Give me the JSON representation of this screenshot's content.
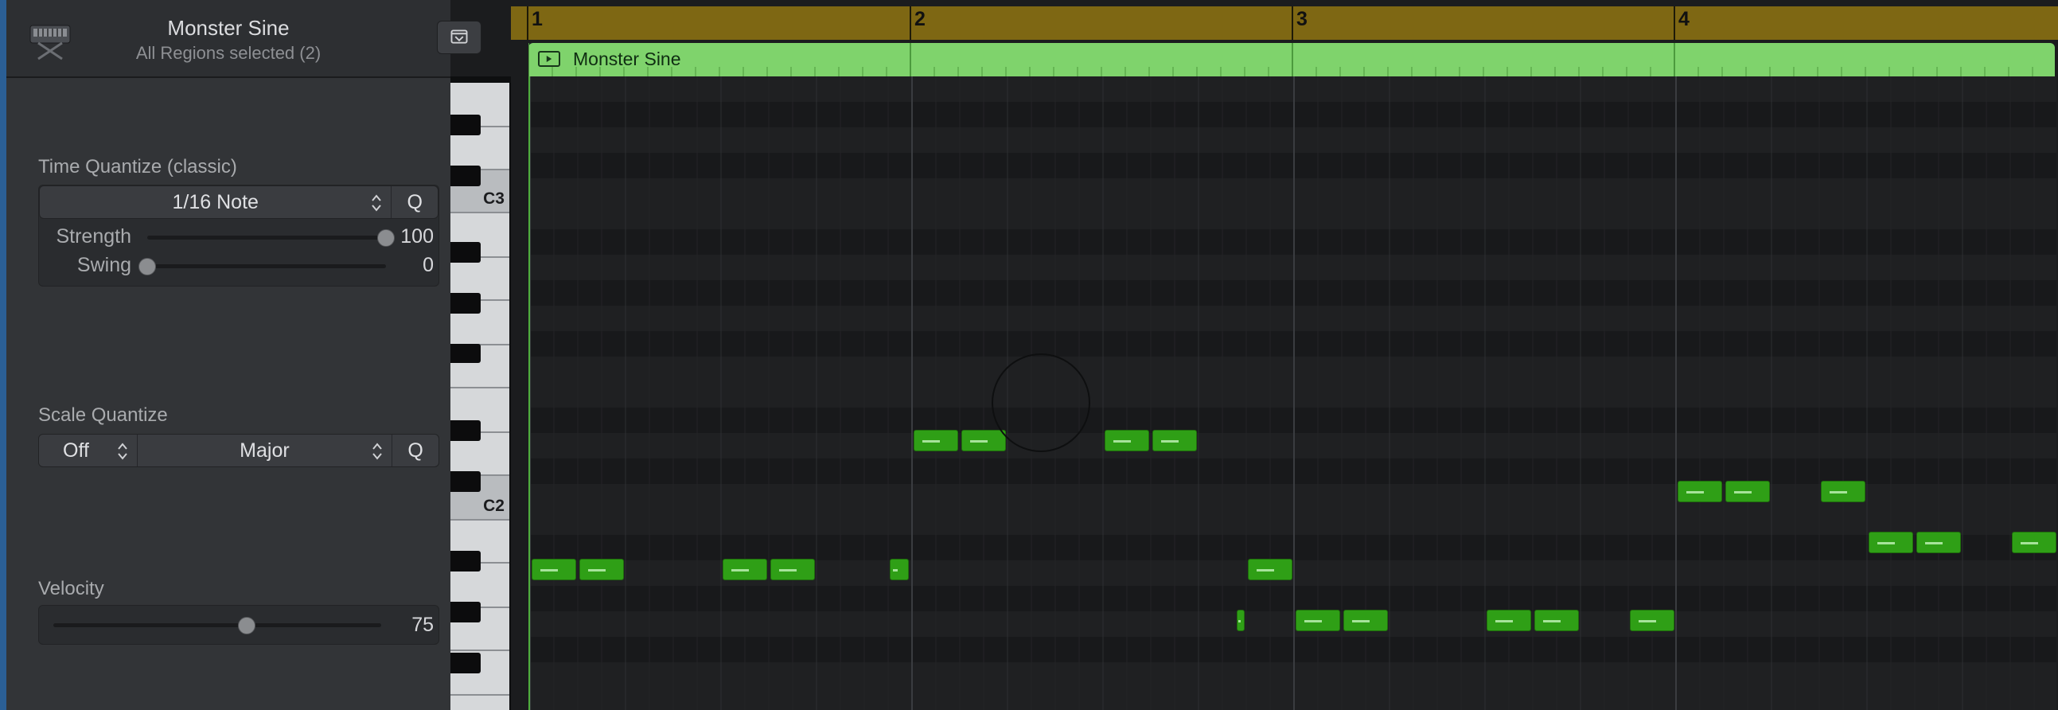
{
  "header": {
    "region_name": "Monster Sine",
    "region_sub": "All Regions selected (2)"
  },
  "time_quantize": {
    "title": "Time Quantize (classic)",
    "value": "1/16 Note",
    "q_label": "Q",
    "strength_label": "Strength",
    "strength_value": "100",
    "strength_level": 1.0,
    "swing_label": "Swing",
    "swing_value": "0",
    "swing_level": 0.0
  },
  "scale_quantize": {
    "title": "Scale Quantize",
    "root": "Off",
    "scale": "Major",
    "q_label": "Q"
  },
  "velocity": {
    "title": "Velocity",
    "value": "75",
    "level": 0.59
  },
  "piano": {
    "labels": [
      "C3",
      "C2"
    ]
  },
  "ruler": {
    "bars": [
      "1",
      "2",
      "3",
      "4"
    ]
  },
  "region": {
    "name": "Monster Sine",
    "color": "#7fd36c"
  },
  "colors": {
    "ruler": "#7e6713",
    "note": "#2f9f16"
  }
}
